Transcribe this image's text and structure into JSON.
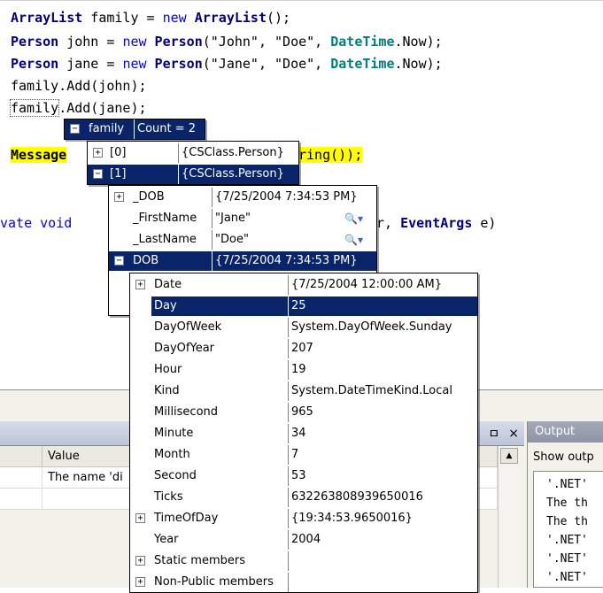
{
  "editor": {
    "lines": {
      "l1": {
        "type1": "ArrayList",
        "mid1": " family = ",
        "kw": "new",
        "type2": " ArrayList",
        "end": "();"
      },
      "l2": {
        "type1": "Person",
        "mid1": " john = ",
        "kw": "new",
        "type2": " Person",
        "args": "(\"John\", \"Doe\", ",
        "type3": "DateTime",
        "end": ".Now);"
      },
      "l3": {
        "type1": "Person",
        "mid1": " jane = ",
        "kw": "new",
        "type2": " Person",
        "args": "(\"Jane\", \"Doe\", ",
        "type3": "DateTime",
        "end": ".Now);"
      },
      "l4": "family.Add(john);",
      "l5a": "family",
      "l5b": ".Add(jane);",
      "l6a": "Message",
      "l6b": "ring());",
      "l7a": "vate void",
      "l7b": "r, ",
      "l7c": "EventArgs",
      "l7d": " e)"
    }
  },
  "tip_family": {
    "name": "family",
    "value": "Count = 2",
    "expander": "−"
  },
  "tip_items": [
    {
      "expander": "+",
      "name": "[0]",
      "value": "{CSClass.Person}"
    },
    {
      "expander": "−",
      "name": "[1]",
      "value": "{CSClass.Person}"
    }
  ],
  "tip_person": [
    {
      "expander": "+",
      "name": "_DOB",
      "value": "{7/25/2004 7:34:53 PM}"
    },
    {
      "name": "_FirstName",
      "value": "\"Jane\"",
      "icon": "magnifier-icon"
    },
    {
      "name": "_LastName",
      "value": "\"Doe\"",
      "icon": "magnifier-icon"
    },
    {
      "expander": "−",
      "name": "DOB",
      "value": "{7/25/2004 7:34:53 PM}"
    }
  ],
  "tip_dob": [
    {
      "expander": "+",
      "name": "Date",
      "value": "{7/25/2004 12:00:00 AM}"
    },
    {
      "name": "Day",
      "value": "25"
    },
    {
      "name": "DayOfWeek",
      "value": "System.DayOfWeek.Sunday"
    },
    {
      "name": "DayOfYear",
      "value": "207"
    },
    {
      "name": "Hour",
      "value": "19"
    },
    {
      "name": "Kind",
      "value": "System.DateTimeKind.Local"
    },
    {
      "name": "Millisecond",
      "value": "965"
    },
    {
      "name": "Minute",
      "value": "34"
    },
    {
      "name": "Month",
      "value": "7"
    },
    {
      "name": "Second",
      "value": "53"
    },
    {
      "name": "Ticks",
      "value": "632263808939650016"
    },
    {
      "expander": "+",
      "name": "TimeOfDay",
      "value": "{19:34:53.9650016}"
    },
    {
      "name": "Year",
      "value": "2004"
    },
    {
      "expander": "+",
      "name": "Static members",
      "value": ""
    },
    {
      "expander": "+",
      "name": "Non-Public members",
      "value": ""
    }
  ],
  "list_panel": {
    "pin_glyph": "ㅁ",
    "close_glyph": "×",
    "column_value": "Value",
    "row1_value": "The name 'di",
    "scroll_up": "▲"
  },
  "output": {
    "title": "Output",
    "toolbar_text": "Show outp",
    "lines": [
      "'.NET'",
      "The th",
      "The th",
      "'.NET'",
      "'.NET'",
      "'.NET'"
    ]
  },
  "colors": {
    "selection": "#0a246a",
    "highlight": "#ffff00",
    "keyword": "#0000ff"
  }
}
